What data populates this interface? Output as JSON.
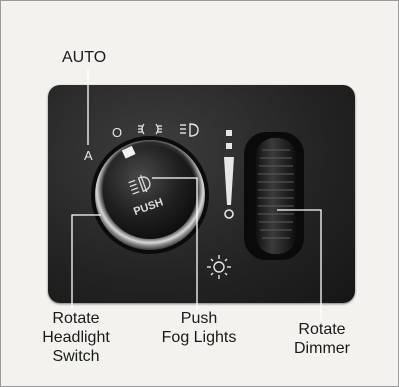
{
  "callouts": {
    "auto": "AUTO",
    "headlight": [
      "Rotate",
      "Headlight",
      "Switch"
    ],
    "fog": [
      "Push",
      "Fog Lights"
    ],
    "dimmer": [
      "Rotate",
      "Dimmer"
    ]
  },
  "panel": {
    "knob_label": "PUSH",
    "auto_marker": "A",
    "off_marker": "O",
    "marks": [
      "parking-lights-icon",
      "headlight-icon",
      "fog-light-icon",
      "interior-light-icon",
      "dome-light-icon"
    ]
  }
}
